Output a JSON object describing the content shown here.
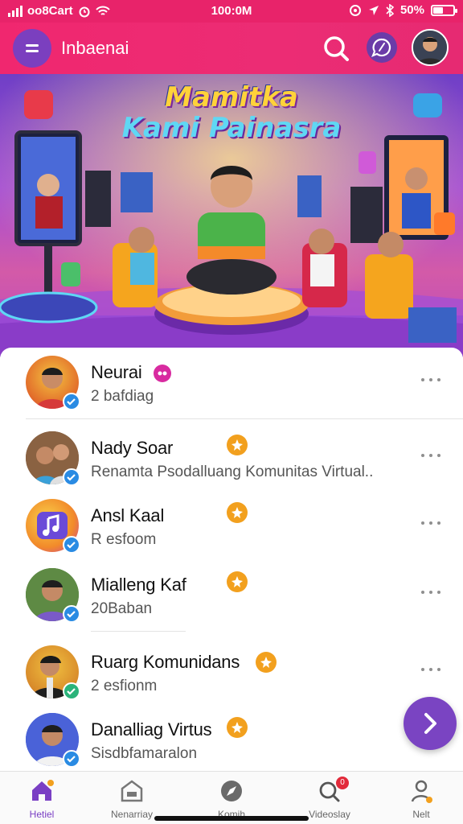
{
  "status_bar": {
    "carrier": "oo8Cart",
    "time": "100:0M",
    "battery": "50%",
    "battery_level": 0.5
  },
  "app_bar": {
    "title": "Inbaenai",
    "icons": [
      "menu-icon",
      "search-icon",
      "chat-icon"
    ]
  },
  "hero": {
    "title_line1": "Mamitka",
    "title_line2": "Kami Painasra"
  },
  "contacts": [
    {
      "name": "Neurai",
      "subtitle": "2 bafdiag",
      "badge": "pink"
    },
    {
      "name": "Nady Soar",
      "subtitle": "Renamta Psodalluang Komunitas Virtual..",
      "badge": "orange"
    },
    {
      "name": "Ansl Kaal",
      "subtitle": "R esfoom",
      "badge": "orange"
    },
    {
      "name": "Mialleng Kaf",
      "subtitle": "20Baban",
      "badge": "orange"
    },
    {
      "name": "Ruarg Komunidans",
      "subtitle": "2 esfionm",
      "badge": "orange"
    },
    {
      "name": "Danalliag Virtus",
      "subtitle": "Sisdbfamaralon",
      "badge": "orange"
    }
  ],
  "fab": {
    "icon": "chevron-right-icon"
  },
  "bottom_nav": [
    {
      "label": "Hetiel",
      "icon": "home-icon",
      "active": true,
      "badge": ""
    },
    {
      "label": "Nenarriay",
      "icon": "store-icon",
      "active": false,
      "badge": ""
    },
    {
      "label": "Komih",
      "icon": "compass-icon",
      "active": false,
      "badge": ""
    },
    {
      "label": "Videoslay",
      "icon": "search-notification-icon",
      "active": false,
      "badge": "0"
    },
    {
      "label": "Nelt",
      "icon": "profile-icon",
      "active": false,
      "badge": ""
    }
  ],
  "colors": {
    "primary": "#ec2c74",
    "accent": "#7a44c2",
    "badge_orange": "#f2a01e",
    "badge_pink": "#d82ba0",
    "verified": "#2a8be3"
  }
}
